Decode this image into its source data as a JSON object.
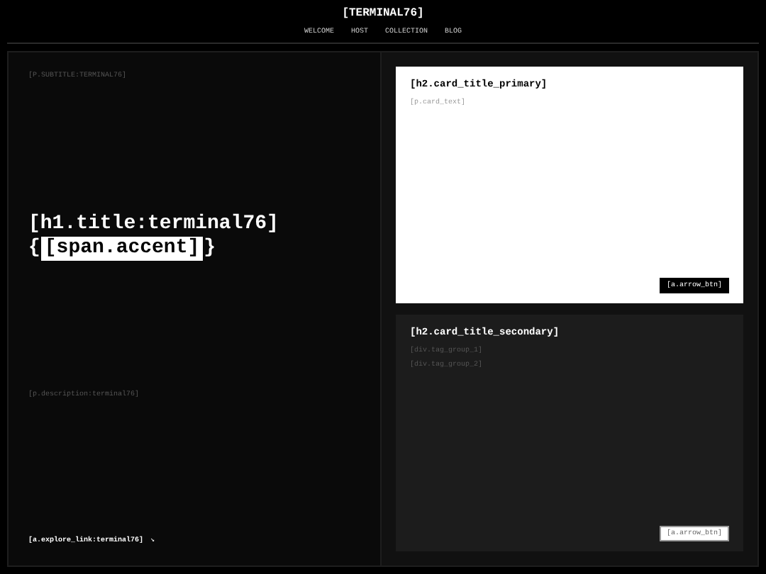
{
  "header": {
    "title": "[TERMINAL76]",
    "nav": [
      "WELCOME",
      "HOST",
      "COLLECTION",
      "BLOG"
    ]
  },
  "hero": {
    "subtitle": "[P.SUBTITLE:TERMINAL76]",
    "title": "[h1.title:terminal76]",
    "accent_open": "{",
    "accent": "[span.accent]",
    "accent_close": "}",
    "description": "[p.description:terminal76]",
    "explore_link": "[a.explore_link:terminal76]",
    "explore_arrow": "↘"
  },
  "cards": [
    {
      "kind": "primary",
      "title": "[h2.card_title_primary]",
      "lines": [
        "[p.card_text]"
      ],
      "button": "[a.arrow_btn]"
    },
    {
      "kind": "secondary",
      "title": "[h2.card_title_secondary]",
      "lines": [
        "[div.tag_group_1]",
        "[div.tag_group_2]"
      ],
      "button": "[a.arrow_btn]"
    }
  ]
}
